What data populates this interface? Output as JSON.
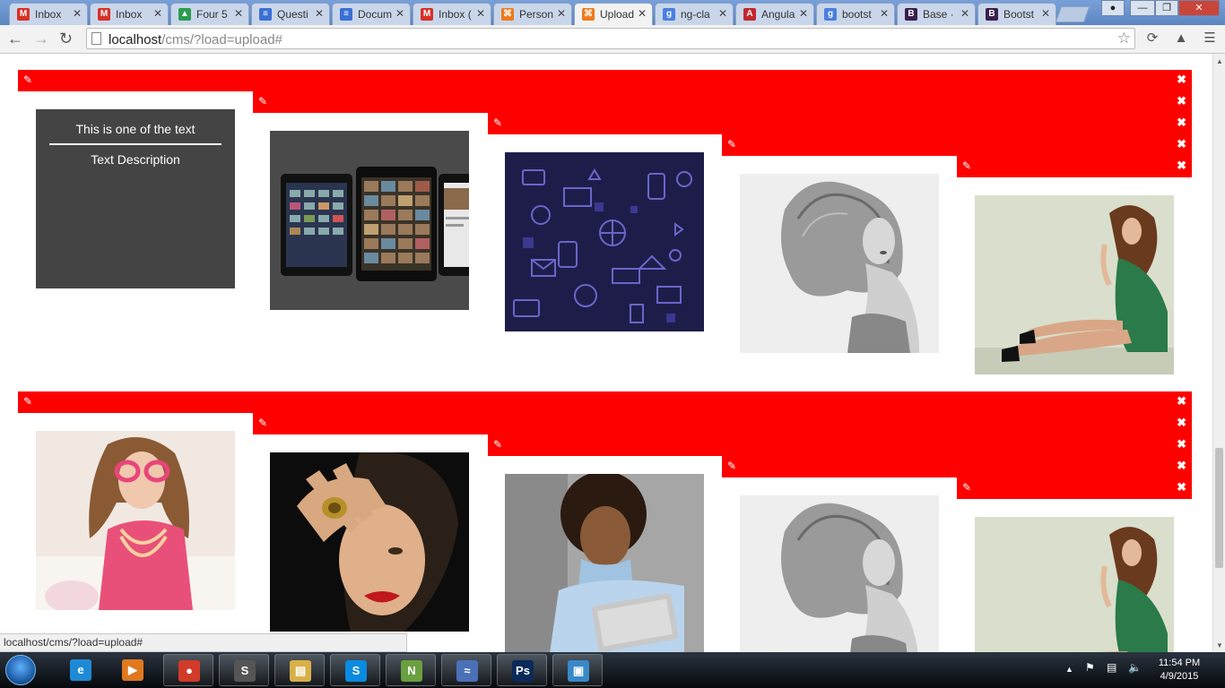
{
  "browser": {
    "tabs": [
      {
        "label": "Inbox",
        "icon": "gmail-icon",
        "color": "#d93025"
      },
      {
        "label": "Inbox",
        "icon": "gmail-icon",
        "color": "#d93025"
      },
      {
        "label": "Four 5",
        "icon": "drive-icon",
        "color": "#2a9d4f"
      },
      {
        "label": "Questi",
        "icon": "docs-icon",
        "color": "#3b6fd4"
      },
      {
        "label": "Docum",
        "icon": "docs-icon",
        "color": "#3b6fd4"
      },
      {
        "label": "Inbox (",
        "icon": "gmail-icon",
        "color": "#d93025"
      },
      {
        "label": "Person",
        "icon": "xampp-icon",
        "color": "#f07a1a"
      },
      {
        "label": "Upload",
        "icon": "xampp-icon",
        "color": "#f07a1a"
      },
      {
        "label": "ng-cla",
        "icon": "google-icon",
        "color": "#4a7fe0"
      },
      {
        "label": "Angula",
        "icon": "angular-icon",
        "color": "#c4262e"
      },
      {
        "label": "bootst",
        "icon": "google-icon",
        "color": "#4a7fe0"
      },
      {
        "label": "Base ·",
        "icon": "bootstrap-icon",
        "color": "#3a1f4e"
      },
      {
        "label": "Bootst",
        "icon": "bootstrap-icon",
        "color": "#3a1f4e"
      }
    ],
    "active_tab": 7,
    "url_host": "localhost",
    "url_path": "/cms/?load=upload#"
  },
  "page": {
    "text_card": {
      "title": "This is one of the text",
      "description": "Text Description"
    },
    "row1_items": [
      {
        "type": "text",
        "name": "text-card"
      },
      {
        "type": "image",
        "name": "tablets-image"
      },
      {
        "type": "image",
        "name": "icon-pattern-image"
      },
      {
        "type": "image",
        "name": "woman-bw-image"
      },
      {
        "type": "image",
        "name": "woman-green-dress-image"
      }
    ],
    "row2_items": [
      {
        "type": "image",
        "name": "girl-pink-glasses-image"
      },
      {
        "type": "image",
        "name": "woman-hand-rings-image"
      },
      {
        "type": "image",
        "name": "woman-tablet-image"
      },
      {
        "type": "image",
        "name": "woman-bw-image"
      },
      {
        "type": "image",
        "name": "woman-green-dress-image"
      }
    ],
    "bar_color": "#ff0000",
    "edit_icon": "edit-icon",
    "delete_icon": "close-icon"
  },
  "status_bar": {
    "text": "localhost/cms/?load=upload#"
  },
  "taskbar": {
    "apps": [
      {
        "icon": "internet-explorer-icon",
        "open": false
      },
      {
        "icon": "media-player-icon",
        "open": false
      },
      {
        "icon": "chrome-icon",
        "open": true
      },
      {
        "icon": "sublime-text-icon",
        "open": true
      },
      {
        "icon": "file-explorer-icon",
        "open": true
      },
      {
        "icon": "skype-icon",
        "open": true
      },
      {
        "icon": "notepad-plus-icon",
        "open": true
      },
      {
        "icon": "dolphin-icon",
        "open": true
      },
      {
        "icon": "photoshop-icon",
        "open": true
      },
      {
        "icon": "image-viewer-icon",
        "open": true
      }
    ],
    "time": "11:54 PM",
    "date": "4/9/2015"
  }
}
